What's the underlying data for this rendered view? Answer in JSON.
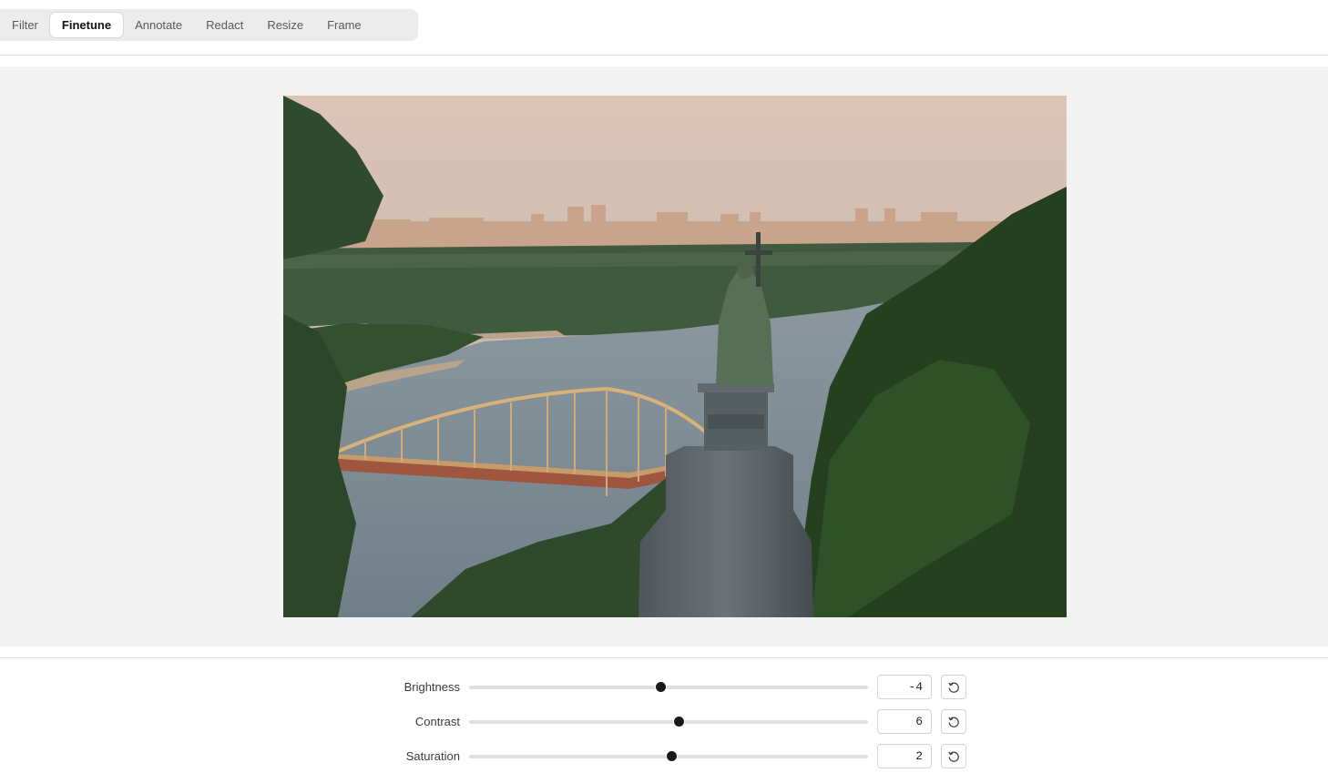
{
  "tabs": [
    {
      "label": "Filter",
      "active": false
    },
    {
      "label": "Finetune",
      "active": true
    },
    {
      "label": "Annotate",
      "active": false
    },
    {
      "label": "Redact",
      "active": false
    },
    {
      "label": "Resize",
      "active": false
    },
    {
      "label": "Frame",
      "active": false
    }
  ],
  "controls": [
    {
      "label": "Brightness",
      "value": "-4",
      "slider_fraction": 0.48
    },
    {
      "label": "Contrast",
      "value": "6",
      "slider_fraction": 0.527
    },
    {
      "label": "Saturation",
      "value": "2",
      "slider_fraction": 0.508
    }
  ],
  "icons": {
    "reset": "reset-icon"
  },
  "colors": {
    "canvas_background": "#f2f2f2",
    "slider_thumb": "#1a1a1a",
    "slider_track": "#e0e0e0"
  }
}
